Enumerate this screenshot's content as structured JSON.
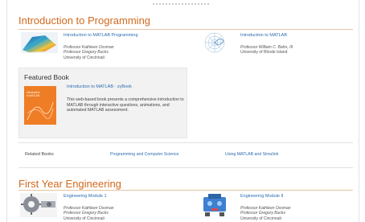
{
  "sections": [
    {
      "title": "Introduction to Programming",
      "items": [
        {
          "link": "Introduction to MATLAB Programming",
          "professors": [
            "Professor Kathleen Ossman",
            "Professor Gregory Bucks"
          ],
          "institution": "University of Cincinnati",
          "thumb_icon": "surface-plot-thumbnail"
        },
        {
          "link": "Introduction to MATLAB",
          "professors": [
            "Professor William C. Bahn, III"
          ],
          "institution": "University of Rhode Island",
          "thumb_icon": "polar-plot-thumbnail"
        }
      ]
    },
    {
      "title": "First Year Engineering",
      "items": [
        {
          "link": "Engineering Module 1",
          "professors": [
            "Professor Kathleen Ossman",
            "Professor Gregory Bucks"
          ],
          "institution": "University of Cincinnati",
          "thumb_icon": "gear-mechanism-thumbnail"
        },
        {
          "link": "Engineering Module II",
          "professors": [
            "Professor Kathleen Ossman",
            "Professor Gregory Bucks"
          ],
          "institution": "University of Cincinnati",
          "thumb_icon": "robot-thumbnail"
        }
      ]
    }
  ],
  "featured": {
    "title": "Featured Book",
    "cover_text": [
      "Introduction",
      "to MATLAB"
    ],
    "link": "Introduction to MATLAB · zyBook",
    "description": "This web-based book presents a comprehensive introduction to MATLAB through interactive questions, animations, and automated MATLAB assessment."
  },
  "related": {
    "label": "Related Books",
    "links": [
      "Programming and Computer Science",
      "Using MATLAB and Simulink"
    ]
  },
  "colors": {
    "heading": "#d2691e",
    "link": "#2b6cb0",
    "book_cover": "#ef7d25"
  }
}
